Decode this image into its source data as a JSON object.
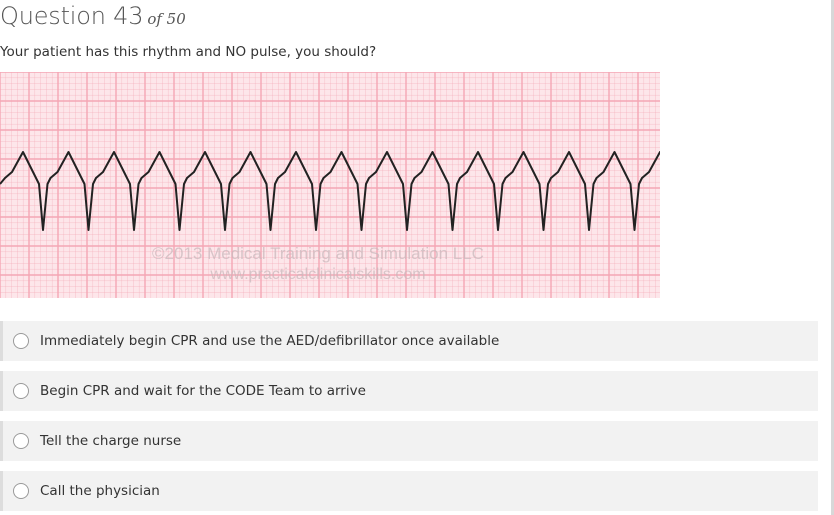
{
  "question": {
    "title": "Question 43",
    "of_text": "of 50",
    "prompt": "Your patient has this rhythm and NO pulse, you should?"
  },
  "rhythm_image": {
    "watermark_line1": "©2013 Medical Training and Simulation LLC",
    "watermark_line2": "www.practicalclinicalskills.com",
    "grid_color": "#f4a6b4",
    "background_color": "#fde6ea",
    "trace_color": "#222222"
  },
  "answers": [
    {
      "label": "Immediately begin CPR and use the AED/defibrillator once available",
      "selected": false
    },
    {
      "label": "Begin CPR and wait for the CODE Team to arrive",
      "selected": false
    },
    {
      "label": "Tell the charge nurse",
      "selected": false
    },
    {
      "label": "Call the physician",
      "selected": false
    }
  ]
}
